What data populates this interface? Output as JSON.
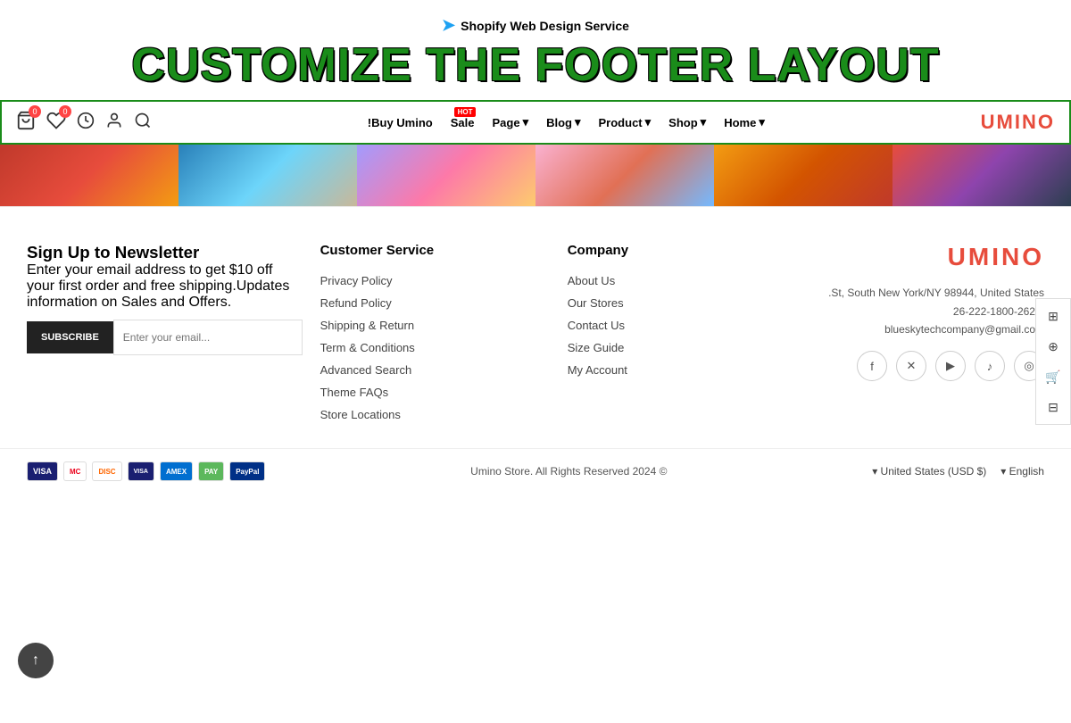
{
  "banner": {
    "shopify_label": "Shopify Web Design Service",
    "headline": "CUSTOMIZE THE FOOTER LAYOUT"
  },
  "navbar": {
    "cart_badge": "0",
    "wishlist_badge": "0",
    "items": [
      {
        "label": "!Buy Umino",
        "hot": false
      },
      {
        "label": "Sale",
        "hot": true
      },
      {
        "label": "Page",
        "hot": false
      },
      {
        "label": "Blog",
        "hot": false
      },
      {
        "label": "Product",
        "hot": false
      },
      {
        "label": "Shop",
        "hot": false
      },
      {
        "label": "Home",
        "hot": false
      }
    ],
    "logo": "UMIN",
    "logo_accent": "O"
  },
  "footer": {
    "newsletter": {
      "title": "Sign Up to Newsletter",
      "description": "Enter your email address to get $10 off your first order and free shipping.Updates information on Sales and Offers.",
      "subscribe_btn": "SUBSCRIBE",
      "email_placeholder": "Enter your email..."
    },
    "customer_service": {
      "title": "Customer Service",
      "links": [
        "Privacy Policy",
        "Refund Policy",
        "Shipping & Return",
        "Term & Conditions",
        "Advanced Search",
        "Theme FAQs",
        "Store Locations"
      ]
    },
    "company": {
      "title": "Company",
      "links": [
        "About Us",
        "Our Stores",
        "Contact Us",
        "Size Guide",
        "My Account"
      ]
    },
    "brand": {
      "logo_main": "UMIN",
      "logo_accent": "O",
      "address": ".St, South New York/NY 98944, United States 26-222-1800-2628.",
      "email": "blueskytechcompany@gmail.com"
    },
    "social": [
      {
        "name": "facebook",
        "icon": "f"
      },
      {
        "name": "twitter-x",
        "icon": "✕"
      },
      {
        "name": "youtube",
        "icon": "▶"
      },
      {
        "name": "tiktok",
        "icon": "♪"
      },
      {
        "name": "instagram",
        "icon": "◎"
      }
    ],
    "bottom": {
      "copyright": "Umino Store. All Rights Reserved 2024 ©",
      "country": "United States (USD $)",
      "language": "English"
    },
    "payment_methods": [
      "VISA",
      "MC",
      "DISCOVER",
      "VISA2",
      "AMEX",
      "PAY",
      "PayPal"
    ]
  }
}
